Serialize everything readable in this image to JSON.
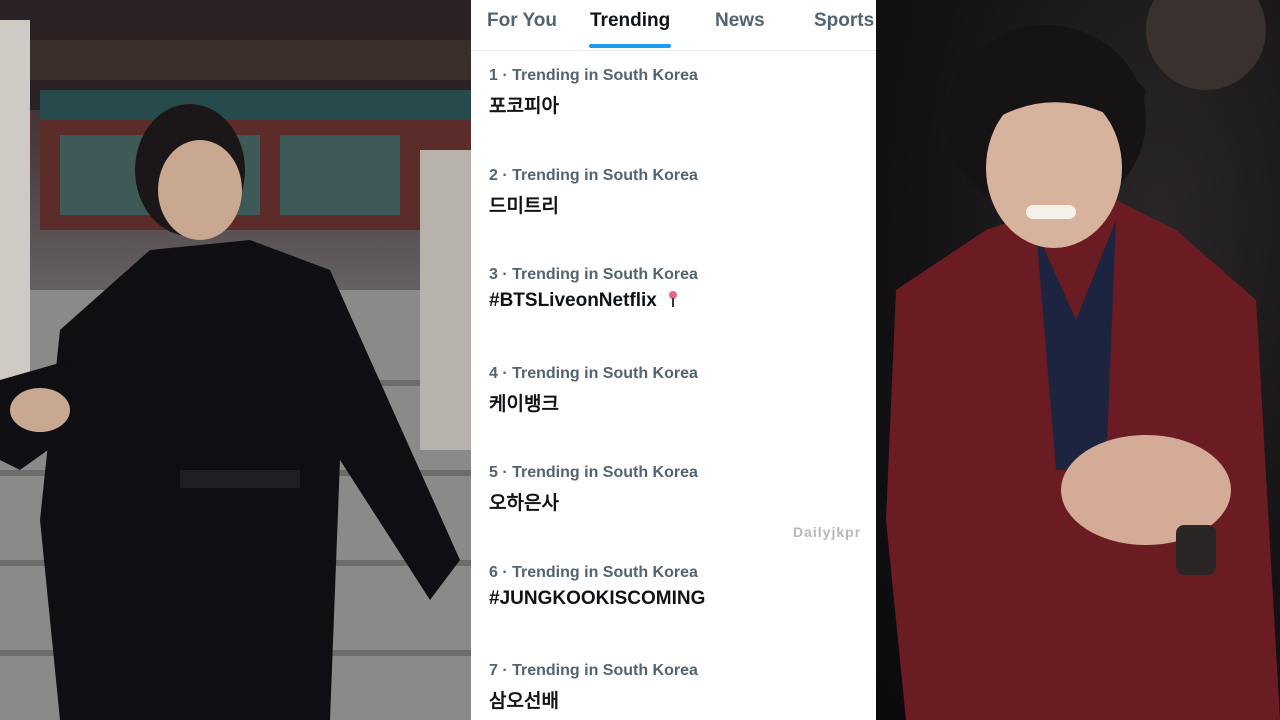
{
  "tabs": {
    "for_you": "For You",
    "trending": "Trending",
    "news": "News",
    "sports": "Sports",
    "active": "Trending"
  },
  "trends": [
    {
      "meta": "1 · Trending in South Korea",
      "name": "포코피아"
    },
    {
      "meta": "2 · Trending in South Korea",
      "name": "드미트리"
    },
    {
      "meta": "3 · Trending in South Korea",
      "name": "#BTSLiveonNetflix"
    },
    {
      "meta": "4 · Trending in South Korea",
      "name": "케이뱅크"
    },
    {
      "meta": "5 · Trending in South Korea",
      "name": "오하은사"
    },
    {
      "meta": "6 · Trending in South Korea",
      "name": "#JUNGKOOKISCOMING"
    },
    {
      "meta": "7 · Trending in South Korea",
      "name": "삼오선배"
    }
  ],
  "watermark": "Dailyjkpr",
  "colors": {
    "accent": "#1d9bf0",
    "text_primary": "#0f1419",
    "text_secondary": "#536471"
  },
  "icons": {
    "hashtag_emoji": "bts-lightstick-icon"
  }
}
